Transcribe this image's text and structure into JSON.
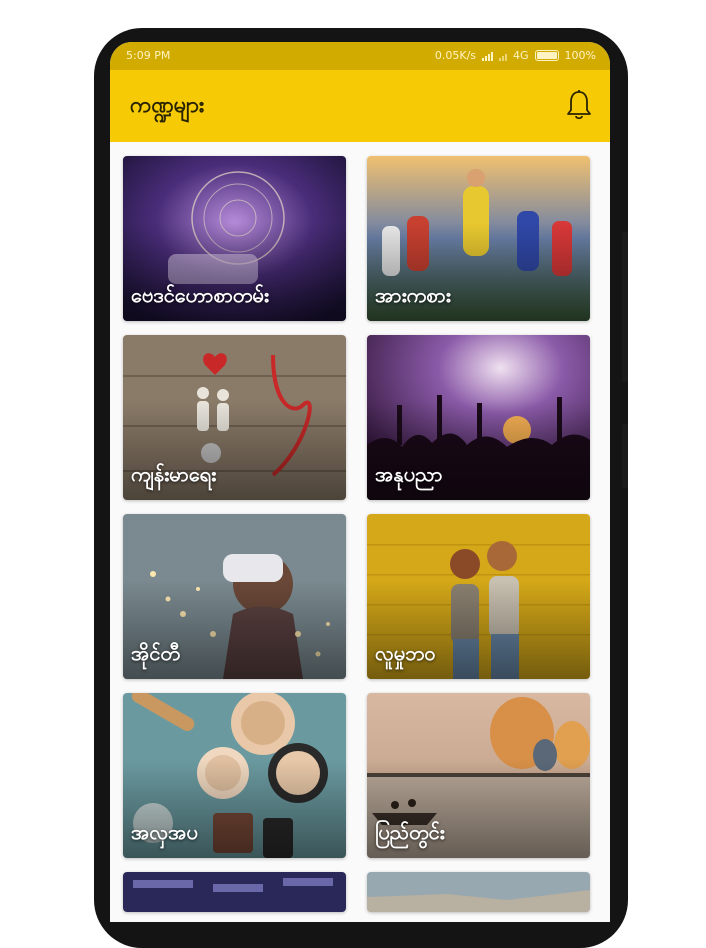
{
  "status_bar": {
    "time": "5:09 PM",
    "speed": "0.05K/s",
    "network": "4G",
    "battery": "100%"
  },
  "app_bar": {
    "title": "ကဏ္ဍများ",
    "bell_icon": "bell-icon"
  },
  "categories": [
    {
      "label": "ဗေဒင်ဟောစာတမ်း",
      "image": "astrology-image"
    },
    {
      "label": "အားကစား",
      "image": "sports-image"
    },
    {
      "label": "ကျန်းမာရေး",
      "image": "health-image"
    },
    {
      "label": "အနုပညာ",
      "image": "concert-image"
    },
    {
      "label": "အိုင်တီ",
      "image": "vr-image"
    },
    {
      "label": "လူမှုဘဝ",
      "image": "friends-image"
    },
    {
      "label": "အလှအပ",
      "image": "cosmetics-image"
    },
    {
      "label": "ပြည်တွင်း",
      "image": "bagan-image"
    },
    {
      "label": "",
      "image": "news-image"
    },
    {
      "label": "",
      "image": "landscape-image"
    }
  ],
  "colors": {
    "app_bar": "#f6cb05",
    "status_bar": "#d1ab00"
  }
}
